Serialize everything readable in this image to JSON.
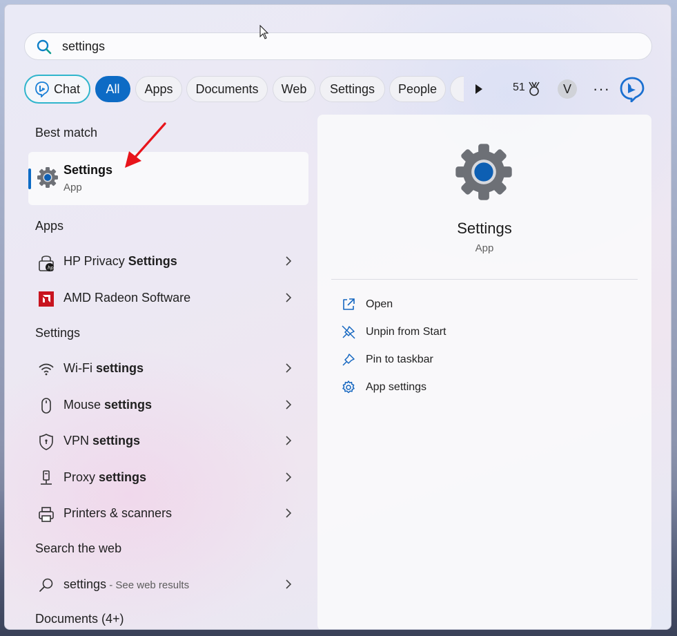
{
  "search": {
    "value": "settings"
  },
  "chips": {
    "chat": "Chat",
    "all": "All",
    "apps": "Apps",
    "documents": "Documents",
    "web": "Web",
    "settings": "Settings",
    "people": "People",
    "points": "51",
    "avatar_initial": "V",
    "more": "···"
  },
  "sections": {
    "best_match": "Best match",
    "apps": "Apps",
    "settings": "Settings",
    "search_web": "Search the web",
    "documents": "Documents (4+)"
  },
  "best_match": {
    "title": "Settings",
    "subtitle": "App"
  },
  "apps": [
    {
      "pre": "HP Privacy ",
      "bold": "Settings"
    },
    {
      "pre": "AMD Radeon Software",
      "bold": ""
    }
  ],
  "settings_items": [
    {
      "pre": "Wi-Fi ",
      "bold": "settings"
    },
    {
      "pre": "Mouse ",
      "bold": "settings"
    },
    {
      "pre": "VPN ",
      "bold": "settings"
    },
    {
      "pre": "Proxy ",
      "bold": "settings"
    },
    {
      "pre": "Printers & scanners",
      "bold": ""
    }
  ],
  "web": {
    "query": "settings",
    "suffix": " - See web results"
  },
  "preview": {
    "title": "Settings",
    "subtitle": "App",
    "actions": [
      "Open",
      "Unpin from Start",
      "Pin to taskbar",
      "App settings"
    ]
  },
  "colors": {
    "accent": "#0d6bc5",
    "chat_border": "#2fb5cc",
    "arrow": "#e8141b"
  }
}
